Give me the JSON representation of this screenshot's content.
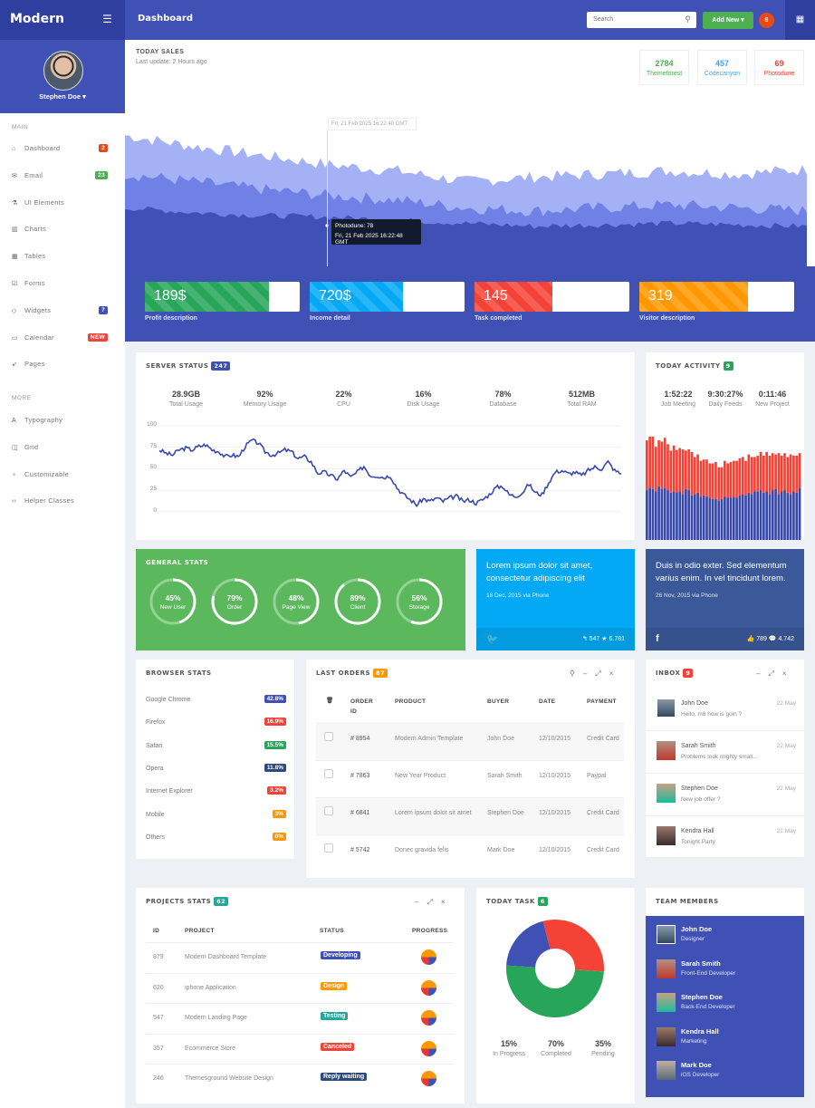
{
  "brand": {
    "logo": "Modern",
    "menu_icon": "hamburger-icon"
  },
  "header": {
    "title": "Dashboard",
    "search_placeholder": "Search",
    "add_new_label": "Add New ▾",
    "notification_count": "6",
    "apps_icon": "grid-icon"
  },
  "user": {
    "name": "Stephen Doe ▾"
  },
  "sidebar": {
    "main_label": "MAIN",
    "more_label": "MORE",
    "main_items": [
      {
        "label": "Dashboard",
        "icon": "home-icon",
        "badge": "2",
        "badge_color": "#e64a19"
      },
      {
        "label": "Email",
        "icon": "envelope-icon",
        "badge": "23",
        "badge_color": "#4caf50"
      },
      {
        "label": "UI Elements",
        "icon": "flask-icon",
        "badge": "",
        "badge_color": ""
      },
      {
        "label": "Charts",
        "icon": "bar-chart-icon",
        "badge": "",
        "badge_color": ""
      },
      {
        "label": "Tables",
        "icon": "table-icon",
        "badge": "",
        "badge_color": ""
      },
      {
        "label": "Forms",
        "icon": "checkbox-icon",
        "badge": "",
        "badge_color": ""
      },
      {
        "label": "Widgets",
        "icon": "diamond-icon",
        "badge": "7",
        "badge_color": "#3f51b5"
      },
      {
        "label": "Calendar",
        "icon": "calendar-icon",
        "badge": "NEW",
        "badge_color": "#f44336"
      },
      {
        "label": "Pages",
        "icon": "paper-plane-icon",
        "badge": "",
        "badge_color": ""
      }
    ],
    "more_items": [
      {
        "label": "Typography",
        "icon": "font-icon"
      },
      {
        "label": "Grid",
        "icon": "columns-icon"
      },
      {
        "label": "Customizable",
        "icon": "lightbulb-icon"
      },
      {
        "label": "Helper Classes",
        "icon": "code-icon"
      }
    ]
  },
  "sales": {
    "title": "TODAY SALES",
    "subtitle": "Last update: 2 Hours ago",
    "stats": [
      {
        "value": "2784",
        "label": "Themeforest",
        "color": "#4caf50"
      },
      {
        "value": "457",
        "label": "Codecanyon",
        "color": "#42a5f5"
      },
      {
        "value": "69",
        "label": "Photodune",
        "color": "#f44336"
      }
    ],
    "crosshair_label": "Fri, 21 Feb 2025 16:22:48 GMT",
    "tooltip_line1": "Photodune: 78",
    "tooltip_line2": "Fri, 21 Feb 2025 16:22:48 GMT",
    "progress": [
      {
        "value": "189$",
        "label": "Profit description",
        "fill": 0.8,
        "color": "#27a659"
      },
      {
        "value": "720$",
        "label": "Income detail",
        "fill": 0.6,
        "color": "#03a9f4"
      },
      {
        "value": "145",
        "label": "Task completed",
        "fill": 0.5,
        "color": "#f44336"
      },
      {
        "value": "319",
        "label": "Visitor description",
        "fill": 0.7,
        "color": "#ff9800"
      }
    ]
  },
  "server": {
    "title": "SERVER STATUS",
    "badge": "247",
    "stats": [
      {
        "value": "28.9GB",
        "label": "Total Usage"
      },
      {
        "value": "92%",
        "label": "Memory Usage"
      },
      {
        "value": "22%",
        "label": "CPU"
      },
      {
        "value": "16%",
        "label": "Disk Usage"
      },
      {
        "value": "78%",
        "label": "Database"
      },
      {
        "value": "512MB",
        "label": "Total RAM"
      }
    ]
  },
  "activity": {
    "title": "TODAY ACTIVITY",
    "badge": "9",
    "stats": [
      {
        "value": "1:52:22",
        "label": "Job Meeting"
      },
      {
        "value": "9:30:27%",
        "label": "Daily Feeds"
      },
      {
        "value": "0:11:46",
        "label": "New Project"
      }
    ]
  },
  "general_stats": {
    "title": "GENERAL STATS",
    "rings": [
      {
        "value": "45%",
        "label": "New User",
        "fraction": 0.45
      },
      {
        "value": "79%",
        "label": "Order",
        "fraction": 0.79
      },
      {
        "value": "48%",
        "label": "Page View",
        "fraction": 0.48
      },
      {
        "value": "89%",
        "label": "Client",
        "fraction": 0.89
      },
      {
        "value": "56%",
        "label": "Storage",
        "fraction": 0.56
      }
    ]
  },
  "twitter": {
    "message": "Lorem ipsum dolor sit amet, consectetur adipiscing elit",
    "meta": "18 Dec, 2015 via Phone",
    "counts": "↰ 547  ★ 6.781",
    "color": "#03a9f4"
  },
  "facebook": {
    "message": "Duis in odio exter. Sed elementum varius enim. In vel tincidunt lorem.",
    "meta": "26 Nov, 2015 via Phone",
    "counts": "👍 789  💬 4.742",
    "color": "#3b5998"
  },
  "browser": {
    "title": "BROWSER STATS",
    "items": [
      {
        "name": "Google Chrome",
        "value": "42.8%",
        "color": "#3f51b5"
      },
      {
        "name": "Firefox",
        "value": "16.9%",
        "color": "#f44336"
      },
      {
        "name": "Safari",
        "value": "15.5%",
        "color": "#27a659"
      },
      {
        "name": "Opera",
        "value": "11.8%",
        "color": "#2c4a7a"
      },
      {
        "name": "Internet Explorer",
        "value": "3.2%",
        "color": "#f44336"
      },
      {
        "name": "Mobile",
        "value": "3%",
        "color": "#ff9800"
      },
      {
        "name": "Others",
        "value": "0%",
        "color": "#ff9800"
      }
    ]
  },
  "orders": {
    "title": "LAST ORDERS",
    "badge": "87",
    "headers": [
      "ORDER ID",
      "PRODUCT",
      "BUYER",
      "DATE",
      "PAYMENT"
    ],
    "rows": [
      {
        "id": "# 8954",
        "product": "Modern Admin Template",
        "buyer": "John Doe",
        "date": "12/10/2015",
        "payment": "Credit Card"
      },
      {
        "id": "# 7863",
        "product": "New Year Product",
        "buyer": "Sarah Smith",
        "date": "12/10/2015",
        "payment": "Paypal"
      },
      {
        "id": "# 6841",
        "product": "Lorem ipsum dolor sit amet",
        "buyer": "Stephen Doe",
        "date": "12/10/2015",
        "payment": "Credit Card"
      },
      {
        "id": "# 5742",
        "product": "Donec gravida felis",
        "buyer": "Mark Doe",
        "date": "12/10/2015",
        "payment": "Credit Card"
      }
    ]
  },
  "inbox": {
    "title": "INBOX",
    "badge": "9",
    "messages": [
      {
        "name": "John Doe",
        "text": "Hello, m8 how is goin ?",
        "date": "22 May"
      },
      {
        "name": "Sarah Smith",
        "text": "Problems look mighty small...",
        "date": "22 May"
      },
      {
        "name": "Stephen Doe",
        "text": "New job offer ?",
        "date": "22 May"
      },
      {
        "name": "Kendra Hall",
        "text": "Tonight Party",
        "date": "22 May"
      }
    ]
  },
  "projects": {
    "title": "PROJECTS STATS",
    "badge": "62",
    "headers": [
      "ID",
      "PROJECT",
      "STATUS",
      "PROGRESS"
    ],
    "rows": [
      {
        "id": "879",
        "name": "Modern Dashboard Template",
        "status": "Developing",
        "color": "#3f51b5"
      },
      {
        "id": "620",
        "name": "iphone Application",
        "status": "Design",
        "color": "#ff9800"
      },
      {
        "id": "547",
        "name": "Modern Landing Page",
        "status": "Testing",
        "color": "#26a69a"
      },
      {
        "id": "357",
        "name": "Ecommerce Store",
        "status": "Canceled",
        "color": "#f44336"
      },
      {
        "id": "246",
        "name": "Themesground Website Design",
        "status": "Reply waiting",
        "color": "#2c4a7a"
      }
    ]
  },
  "today_task": {
    "title": "TODAY TASK",
    "badge": "6",
    "stats": [
      {
        "value": "15%",
        "label": "In Progress"
      },
      {
        "value": "70%",
        "label": "Completed"
      },
      {
        "value": "35%",
        "label": "Pending"
      }
    ]
  },
  "team": {
    "title": "TEAM MEMBERS",
    "members": [
      {
        "name": "John Doe",
        "role": "Designer"
      },
      {
        "name": "Sarah Smith",
        "role": "Front-End Developer"
      },
      {
        "name": "Stephen Doe",
        "role": "Back-End Developer"
      },
      {
        "name": "Kendra Hall",
        "role": "Marketing"
      },
      {
        "name": "Mark Doe",
        "role": "iOS Developer"
      }
    ]
  },
  "chart_data": [
    {
      "type": "area",
      "title": "Today Sales",
      "series": [
        {
          "name": "Themeforest",
          "color": "#a4b1f5",
          "trend": [
            0.85,
            0.78,
            0.72,
            0.66,
            0.62,
            0.55,
            0.58,
            0.6,
            0.62,
            0.6,
            0.63
          ]
        },
        {
          "name": "Codecanyon",
          "color": "#6f81e4",
          "trend": [
            0.6,
            0.55,
            0.5,
            0.46,
            0.43,
            0.38,
            0.36,
            0.38,
            0.4,
            0.38,
            0.36
          ]
        },
        {
          "name": "Photodune",
          "color": "#3f51b5",
          "trend": [
            0.38,
            0.35,
            0.33,
            0.32,
            0.3,
            0.28,
            0.26,
            0.27,
            0.28,
            0.27,
            0.26
          ]
        }
      ],
      "tooltip": {
        "series": "Photodune",
        "value": 78
      }
    },
    {
      "type": "line",
      "title": "Server Status",
      "ylim": [
        0,
        100
      ],
      "yticks": [
        "100",
        "75",
        "50",
        "25",
        "0"
      ],
      "values": [
        72,
        68,
        66,
        72,
        74,
        72,
        76,
        78,
        72,
        70,
        64,
        66,
        64,
        76,
        83,
        80,
        70,
        66,
        68,
        72,
        70,
        62,
        64,
        58,
        45,
        46,
        42,
        38,
        48,
        40,
        46,
        53,
        42,
        42,
        40,
        42,
        28,
        20,
        14,
        8,
        15,
        12,
        16,
        12,
        16,
        18,
        12,
        14,
        10,
        14,
        20,
        28,
        30,
        20,
        18,
        22,
        32,
        22,
        20,
        34,
        46,
        48,
        44,
        46,
        42,
        48,
        52,
        50,
        58,
        48,
        44
      ]
    },
    {
      "type": "bar",
      "title": "Today Activity",
      "stacked": true,
      "series": [
        {
          "name": "blue",
          "color": "#3949ab",
          "values": [
            78,
            82,
            80,
            76,
            84,
            80,
            82,
            78,
            74,
            76,
            75,
            76,
            72,
            80,
            78,
            70,
            72,
            74,
            68,
            70,
            68,
            66,
            64,
            64,
            62,
            64,
            68,
            66,
            66,
            68,
            66,
            70,
            72,
            70,
            74,
            72,
            76,
            76,
            78,
            74,
            76,
            72,
            78,
            80,
            72,
            76,
            78,
            74,
            72,
            76,
            74,
            82
          ]
        },
        {
          "name": "red",
          "color": "#f44336",
          "values": [
            78,
            80,
            82,
            70,
            72,
            74,
            78,
            72,
            66,
            72,
            66,
            68,
            70,
            60,
            64,
            68,
            58,
            60,
            56,
            56,
            58,
            54,
            56,
            58,
            52,
            50,
            56,
            54,
            56,
            56,
            58,
            58,
            58,
            54,
            60,
            58,
            54,
            56,
            60,
            58,
            62,
            60,
            58,
            54,
            64,
            56,
            58,
            56,
            62,
            56,
            58,
            54
          ]
        }
      ]
    },
    {
      "type": "pie",
      "title": "Today Task",
      "donut": true,
      "slices": [
        {
          "name": "Red",
          "value": 30,
          "color": "#f44336"
        },
        {
          "name": "Green",
          "value": 50,
          "color": "#27a659"
        },
        {
          "name": "Blue",
          "value": 20,
          "color": "#3f51b5"
        }
      ]
    }
  ]
}
